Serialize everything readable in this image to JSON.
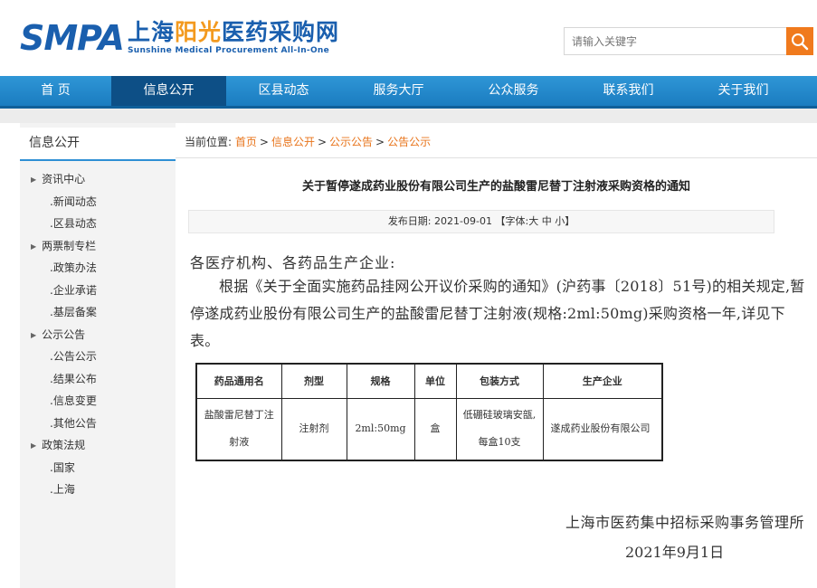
{
  "header": {
    "logo_mark": "SMPA",
    "logo_cn_part1": "上海",
    "logo_cn_part2": "阳光",
    "logo_cn_part3": "医药",
    "logo_cn_part4": "采购网",
    "logo_en": "Sunshine Medical Procurement All-In-One",
    "search_placeholder": "请输入关键字",
    "search_icon": "search-icon",
    "brand_color": "#1a5fae",
    "accent_color": "#f07a1d"
  },
  "nav": {
    "items": [
      {
        "label": "首 页"
      },
      {
        "label": "信息公开"
      },
      {
        "label": "区县动态"
      },
      {
        "label": "服务大厅"
      },
      {
        "label": "公众服务"
      },
      {
        "label": "联系我们"
      },
      {
        "label": "关于我们"
      }
    ],
    "active_index": 1,
    "bar_color": "#1a7cc0",
    "active_color": "#0d4f86"
  },
  "sidebar": {
    "title": "信息公开",
    "items": [
      {
        "label": "资讯中心",
        "type": "category"
      },
      {
        "label": ".新闻动态",
        "type": "sub"
      },
      {
        "label": ".区县动态",
        "type": "sub"
      },
      {
        "label": "两票制专栏",
        "type": "category"
      },
      {
        "label": ".政策办法",
        "type": "sub"
      },
      {
        "label": ".企业承诺",
        "type": "sub"
      },
      {
        "label": ".基层备案",
        "type": "sub"
      },
      {
        "label": "公示公告",
        "type": "category"
      },
      {
        "label": ".公告公示",
        "type": "sub"
      },
      {
        "label": ".结果公布",
        "type": "sub"
      },
      {
        "label": ".信息变更",
        "type": "sub"
      },
      {
        "label": ".其他公告",
        "type": "sub"
      },
      {
        "label": "政策法规",
        "type": "category"
      },
      {
        "label": ".国家",
        "type": "sub"
      },
      {
        "label": ".上海",
        "type": "sub"
      }
    ]
  },
  "breadcrumb": {
    "prefix": "当前位置:",
    "items": [
      "首页",
      "信息公开",
      "公示公告",
      "公告公示"
    ],
    "separator": ">",
    "link_color": "#e8741b"
  },
  "article": {
    "title": "关于暂停遂成药业股份有限公司生产的盐酸雷尼替丁注射液采购资格的通知",
    "date_label": "发布日期:",
    "date": "2021-09-01",
    "font_size_prefix": "【字体:",
    "font_large": "大",
    "font_medium": "中",
    "font_small": "小",
    "font_size_suffix": "】",
    "greeting": "各医疗机构、各药品生产企业:",
    "paragraph": "根据《关于全面实施药品挂网公开议价采购的通知》(沪药事〔2018〕51号)的相关规定,暂停遂成药业股份有限公司生产的盐酸雷尼替丁注射液(规格:2ml:50mg)采购资格一年,详见下表。",
    "table": {
      "headers": [
        "药品通用名",
        "剂型",
        "规格",
        "单位",
        "包装方式",
        "生产企业"
      ],
      "rows": [
        [
          "盐酸雷尼替丁注射液",
          "注射剂",
          "2ml:50mg",
          "盒",
          "低硼硅玻璃安瓿,每盒10支",
          "遂成药业股份有限公司"
        ]
      ]
    },
    "signature_org": "上海市医药集中招标采购事务管理所",
    "signature_date": "2021年9月1日"
  }
}
